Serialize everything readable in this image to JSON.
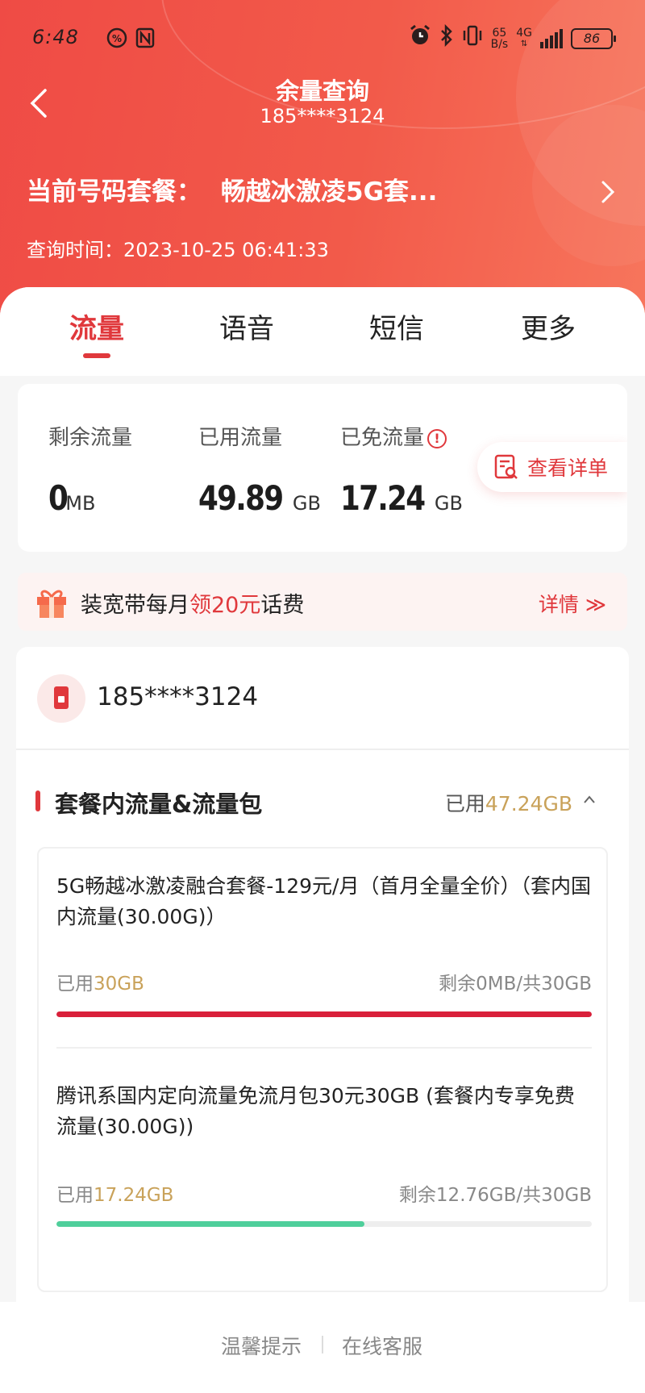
{
  "status_bar": {
    "time": "6:48",
    "net_speed_value": "65",
    "net_speed_unit": "B/s",
    "network_type": "4G",
    "battery": "86"
  },
  "header": {
    "title": "余量查询",
    "subtitle": "185****3124",
    "plan_label": "当前号码套餐：",
    "plan_name": "畅越冰激凌5G套...",
    "query_time": "查询时间：2023-10-25 06:41:33"
  },
  "tabs": [
    {
      "label": "流量",
      "active": true
    },
    {
      "label": "语音",
      "active": false
    },
    {
      "label": "短信",
      "active": false
    },
    {
      "label": "更多",
      "active": false
    }
  ],
  "usage": {
    "remaining": {
      "label": "剩余流量",
      "value": "0",
      "unit": "MB"
    },
    "used": {
      "label": "已用流量",
      "value": "49.89",
      "unit": "GB"
    },
    "free": {
      "label": "已免流量",
      "value": "17.24",
      "unit": "GB"
    },
    "detail_button": "查看详单"
  },
  "promo": {
    "text_pre": "装宽带每月",
    "text_highlight": "领20元",
    "text_post": "话费",
    "more": "详情 ≫"
  },
  "detail": {
    "phone": "185****3124",
    "section_title": "套餐内流量&流量包",
    "section_used_label": "已用",
    "section_used_value": "47.24GB",
    "items": [
      {
        "name": "5G畅越冰激凌融合套餐-129元/月（首月全量全价）（套内国内流量(30.00G)）",
        "used_label": "已用",
        "used_value": "30GB",
        "rest": "剩余0MB/共30GB",
        "progress": 1.0,
        "color": "#d9203a"
      },
      {
        "name": "腾讯系国内定向流量免流月包30元30GB (套餐内专享免费流量(30.00G))",
        "used_label": "已用",
        "used_value": "17.24GB",
        "rest": "剩余12.76GB/共30GB",
        "progress": 0.5747,
        "color": "#4fcf9b"
      }
    ]
  },
  "footer": {
    "tips": "温馨提示",
    "service": "在线客服"
  },
  "colors": {
    "brand_red": "#e0383c",
    "gold": "#c9a25a",
    "header_gradient_start": "#ef4b45",
    "header_gradient_end": "#f7755c"
  }
}
